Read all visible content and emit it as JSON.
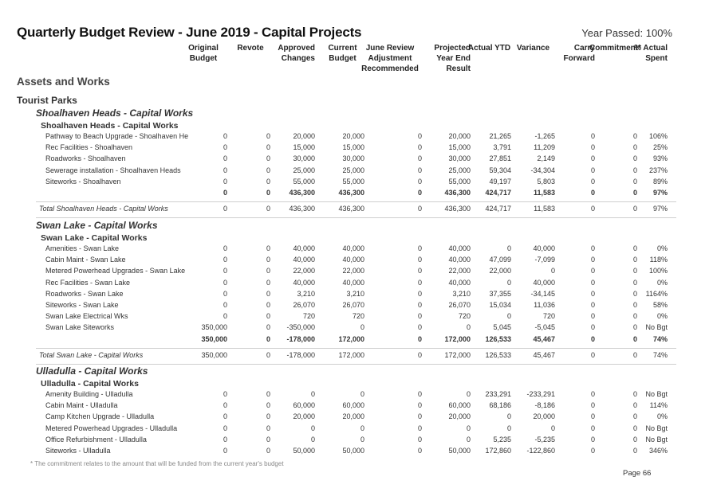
{
  "title": "Quarterly Budget Review - June 2019 - Capital Projects",
  "year_passed": "Year Passed: 100%",
  "columns": [
    {
      "key": "original",
      "label1": "Original",
      "label2": "Budget",
      "label3": ""
    },
    {
      "key": "revote",
      "label1": "Revote",
      "label2": "",
      "label3": ""
    },
    {
      "key": "approved",
      "label1": "Approved",
      "label2": "Changes",
      "label3": ""
    },
    {
      "key": "current",
      "label1": "Current",
      "label2": "Budget",
      "label3": ""
    },
    {
      "key": "june",
      "label1": "June Review",
      "label2": "Adjustment",
      "label3": "Recommended"
    },
    {
      "key": "projected",
      "label1": "Projected",
      "label2": "Year End",
      "label3": "Result"
    },
    {
      "key": "actual",
      "label1": "Actual YTD",
      "label2": "",
      "label3": ""
    },
    {
      "key": "variance",
      "label1": "Variance",
      "label2": "",
      "label3": ""
    },
    {
      "key": "carry",
      "label1": "Carry",
      "label2": "Forward",
      "label3": ""
    },
    {
      "key": "commitment",
      "label1": "Commitment*",
      "label2": "",
      "label3": ""
    },
    {
      "key": "pct",
      "label1": "% Actual",
      "label2": "Spent",
      "label3": ""
    }
  ],
  "section": "Assets and Works",
  "subsection": "Tourist Parks",
  "groups": [
    {
      "title": "Shoalhaven Heads - Capital Works",
      "subtitle": "Shoalhaven Heads - Capital Works",
      "rows": [
        {
          "label": "Pathway to Beach Upgrade - Shoalhaven He",
          "values": [
            "0",
            "0",
            "20,000",
            "20,000",
            "0",
            "20,000",
            "21,265",
            "-1,265",
            "0",
            "0",
            "106%"
          ]
        },
        {
          "label": "Rec Facilities - Shoalhaven",
          "values": [
            "0",
            "0",
            "15,000",
            "15,000",
            "0",
            "15,000",
            "3,791",
            "11,209",
            "0",
            "0",
            "25%"
          ]
        },
        {
          "label": "Roadworks - Shoalhaven",
          "values": [
            "0",
            "0",
            "30,000",
            "30,000",
            "0",
            "30,000",
            "27,851",
            "2,149",
            "0",
            "0",
            "93%"
          ]
        },
        {
          "label": "Sewerage installation - Shoalhaven Heads",
          "values": [
            "0",
            "0",
            "25,000",
            "25,000",
            "0",
            "25,000",
            "59,304",
            "-34,304",
            "0",
            "0",
            "237%"
          ]
        },
        {
          "label": "Siteworks - Shoalhaven",
          "values": [
            "0",
            "0",
            "55,000",
            "55,000",
            "0",
            "55,000",
            "49,197",
            "5,803",
            "0",
            "0",
            "89%"
          ]
        }
      ],
      "subtotal": {
        "label": "",
        "values": [
          "0",
          "0",
          "436,300",
          "436,300",
          "0",
          "436,300",
          "424,717",
          "11,583",
          "0",
          "0",
          "97%"
        ]
      },
      "total": {
        "label": "Total Shoalhaven Heads - Capital Works",
        "values": [
          "0",
          "0",
          "436,300",
          "436,300",
          "0",
          "436,300",
          "424,717",
          "11,583",
          "0",
          "0",
          "97%"
        ]
      }
    },
    {
      "title": "Swan Lake - Capital Works",
      "subtitle": "Swan Lake - Capital Works",
      "rows": [
        {
          "label": "Amenities - Swan Lake",
          "values": [
            "0",
            "0",
            "40,000",
            "40,000",
            "0",
            "40,000",
            "0",
            "40,000",
            "0",
            "0",
            "0%"
          ]
        },
        {
          "label": "Cabin Maint - Swan Lake",
          "values": [
            "0",
            "0",
            "40,000",
            "40,000",
            "0",
            "40,000",
            "47,099",
            "-7,099",
            "0",
            "0",
            "118%"
          ]
        },
        {
          "label": "Metered Powerhead Upgrades - Swan Lake",
          "values": [
            "0",
            "0",
            "22,000",
            "22,000",
            "0",
            "22,000",
            "22,000",
            "0",
            "0",
            "0",
            "100%"
          ]
        },
        {
          "label": "Rec Facilities - Swan Lake",
          "values": [
            "0",
            "0",
            "40,000",
            "40,000",
            "0",
            "40,000",
            "0",
            "40,000",
            "0",
            "0",
            "0%"
          ]
        },
        {
          "label": "Roadworks - Swan Lake",
          "values": [
            "0",
            "0",
            "3,210",
            "3,210",
            "0",
            "3,210",
            "37,355",
            "-34,145",
            "0",
            "0",
            "1164%"
          ]
        },
        {
          "label": "Siteworks - Swan Lake",
          "values": [
            "0",
            "0",
            "26,070",
            "26,070",
            "0",
            "26,070",
            "15,034",
            "11,036",
            "0",
            "0",
            "58%"
          ]
        },
        {
          "label": "Swan Lake Electrical Wks",
          "values": [
            "0",
            "0",
            "720",
            "720",
            "0",
            "720",
            "0",
            "720",
            "0",
            "0",
            "0%"
          ]
        },
        {
          "label": "Swan Lake Siteworks",
          "values": [
            "350,000",
            "0",
            "-350,000",
            "0",
            "0",
            "0",
            "5,045",
            "-5,045",
            "0",
            "0",
            "No Bgt"
          ]
        }
      ],
      "subtotal": {
        "label": "",
        "values": [
          "350,000",
          "0",
          "-178,000",
          "172,000",
          "0",
          "172,000",
          "126,533",
          "45,467",
          "0",
          "0",
          "74%"
        ]
      },
      "total": {
        "label": "Total Swan Lake - Capital Works",
        "values": [
          "350,000",
          "0",
          "-178,000",
          "172,000",
          "0",
          "172,000",
          "126,533",
          "45,467",
          "0",
          "0",
          "74%"
        ]
      }
    },
    {
      "title": "Ulladulla - Capital Works",
      "subtitle": "Ulladulla - Capital Works",
      "rows": [
        {
          "label": "Amenity Building - Ulladulla",
          "values": [
            "0",
            "0",
            "0",
            "0",
            "0",
            "0",
            "233,291",
            "-233,291",
            "0",
            "0",
            "No Bgt"
          ]
        },
        {
          "label": "Cabin Maint - Ulladulla",
          "values": [
            "0",
            "0",
            "60,000",
            "60,000",
            "0",
            "60,000",
            "68,186",
            "-8,186",
            "0",
            "0",
            "114%"
          ]
        },
        {
          "label": "Camp Kitchen Upgrade - Ulladulla",
          "values": [
            "0",
            "0",
            "20,000",
            "20,000",
            "0",
            "20,000",
            "0",
            "20,000",
            "0",
            "0",
            "0%"
          ]
        },
        {
          "label": "Metered Powerhead Upgrades - Ulladulla",
          "values": [
            "0",
            "0",
            "0",
            "0",
            "0",
            "0",
            "0",
            "0",
            "0",
            "0",
            "No Bgt"
          ]
        },
        {
          "label": "Office Refurbishment - Ulladulla",
          "values": [
            "0",
            "0",
            "0",
            "0",
            "0",
            "0",
            "5,235",
            "-5,235",
            "0",
            "0",
            "No Bgt"
          ]
        },
        {
          "label": "Siteworks - Ulladulla",
          "values": [
            "0",
            "0",
            "50,000",
            "50,000",
            "0",
            "50,000",
            "172,860",
            "-122,860",
            "0",
            "0",
            "346%"
          ]
        }
      ]
    }
  ],
  "footnote": "* The commitment relates to the amount that will be funded from the current year's budget",
  "page": "Page 66"
}
